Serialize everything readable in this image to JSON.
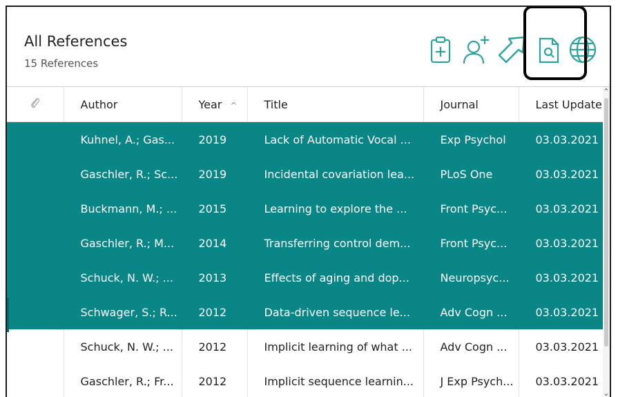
{
  "header": {
    "title": "All References",
    "subtitle": "15 References"
  },
  "toolbar": {
    "icons": [
      "clipboard-add-icon",
      "add-user-icon",
      "share-arrow-icon",
      "document-search-icon",
      "globe-icon"
    ],
    "color": "#2aa39a"
  },
  "table": {
    "columns": [
      "Author",
      "Year",
      "Title",
      "Journal",
      "Last Update"
    ],
    "sort_indicator": "^",
    "selected_color": "#0b8686",
    "rows": [
      {
        "author": "Kuhnel, A.; Gas...",
        "year": "2019",
        "title": "Lack of Automatic Vocal ...",
        "journal": "Exp Psychol",
        "updated": "03.03.2021",
        "selected": true
      },
      {
        "author": "Gaschler, R.; Sc...",
        "year": "2019",
        "title": "Incidental covariation lea...",
        "journal": "PLoS One",
        "updated": "03.03.2021",
        "selected": true
      },
      {
        "author": "Buckmann, M.; ...",
        "year": "2015",
        "title": "Learning to explore the ...",
        "journal": "Front Psyc...",
        "updated": "03.03.2021",
        "selected": true
      },
      {
        "author": "Gaschler, R.; M...",
        "year": "2014",
        "title": "Transferring control dem...",
        "journal": "Front Psyc...",
        "updated": "03.03.2021",
        "selected": true
      },
      {
        "author": "Schuck, N. W.; ...",
        "year": "2013",
        "title": "Effects of aging and dop...",
        "journal": "Neuropsyc...",
        "updated": "03.03.2021",
        "selected": true
      },
      {
        "author": "Schwager, S.; R...",
        "year": "2012",
        "title": "Data-driven sequence le...",
        "journal": "Adv Cogn ...",
        "updated": "03.03.2021",
        "selected": true
      },
      {
        "author": "Schuck, N. W.; ...",
        "year": "2012",
        "title": "Implicit learning of what ...",
        "journal": "Adv Cogn ...",
        "updated": "03.03.2021",
        "selected": false
      },
      {
        "author": "Gaschler, R.; Fr...",
        "year": "2012",
        "title": "Implicit sequence learnin...",
        "journal": "J Exp Psych...",
        "updated": "03.03.2021",
        "selected": false
      }
    ]
  }
}
